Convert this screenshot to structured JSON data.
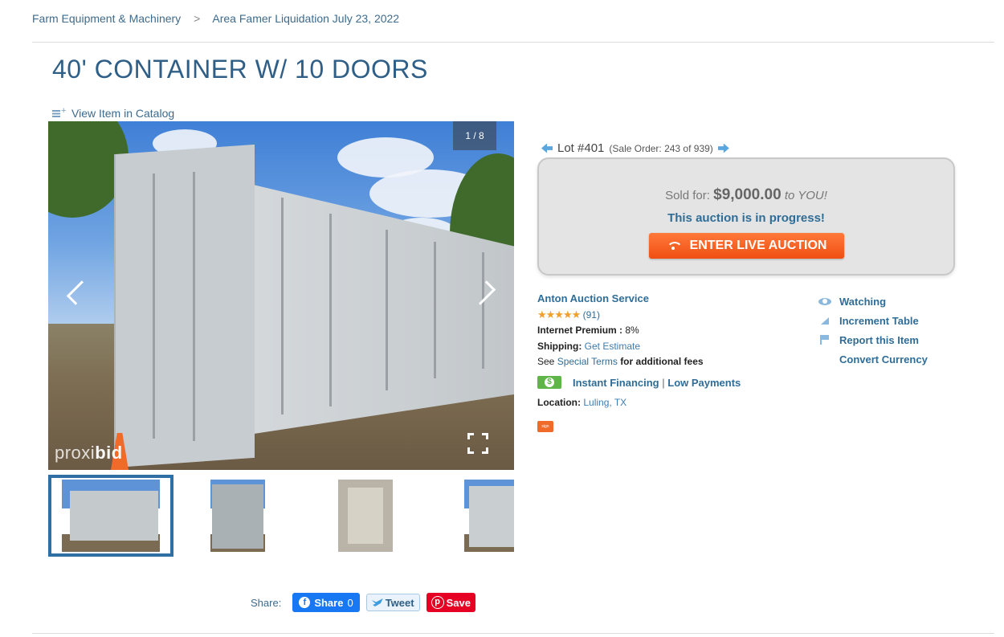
{
  "breadcrumb": {
    "items": [
      "Farm Equipment & Machinery",
      "Area Famer Liquidation July 23, 2022"
    ],
    "separator": ">"
  },
  "lot": {
    "title": "40' CONTAINER W/ 10 DOORS",
    "catalog_link": "View Item in Catalog",
    "number": "Lot #401",
    "sale_order": "(Sale Order: 243 of 939)"
  },
  "gallery": {
    "counter": "1 / 8",
    "watermark_light": "proxi",
    "watermark_bold": "bid"
  },
  "bid": {
    "sold_label": "Sold for:",
    "amount": "$9,000.00",
    "to_you": "to YOU!",
    "status": "This auction is in progress!",
    "live_button": "ENTER LIVE AUCTION",
    "button_color": "#f04e12"
  },
  "seller": {
    "name": "Anton Auction Service",
    "stars": "★★★★★",
    "rating_count": "(91)",
    "premium_label": "Internet Premium :",
    "premium_value": "8%",
    "shipping_label": "Shipping:",
    "shipping_link": "Get Estimate",
    "terms_prefix": "See",
    "terms_link": "Special Terms",
    "terms_suffix": "for additional fees",
    "financing_link": "Instant Financing",
    "financing_sep": "|",
    "payments_link": "Low Payments",
    "location_label": "Location:",
    "location_value": "Luling, TX",
    "sign_badge": "sign"
  },
  "actions": {
    "watching": "Watching",
    "increment_table": "Increment Table",
    "report": "Report this Item",
    "convert_currency": "Convert Currency"
  },
  "share": {
    "label": "Share:",
    "facebook": "Share",
    "facebook_count": "0",
    "tweet": "Tweet",
    "pin": "Save"
  },
  "colors": {
    "link_blue": "#2f6d97",
    "title_blue": "#2f5f86",
    "live_orange": "#f04e12"
  }
}
